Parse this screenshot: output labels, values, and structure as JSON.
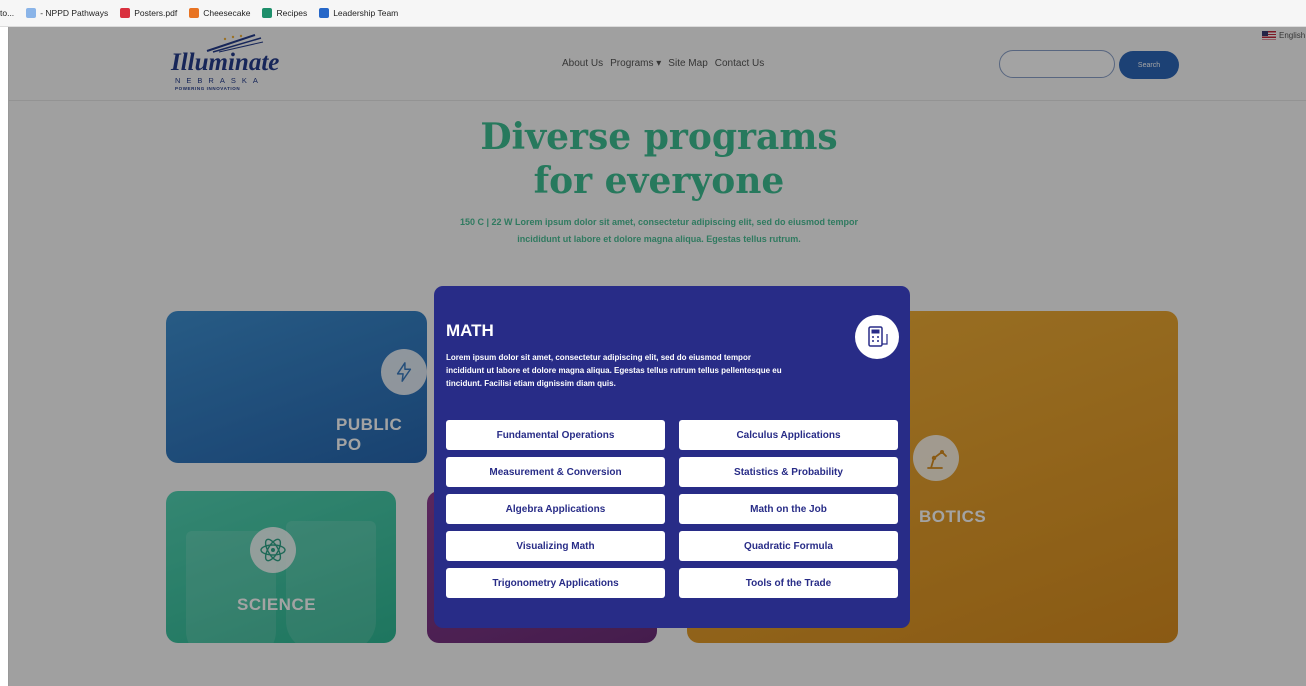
{
  "bookmarks": [
    {
      "label": "to...",
      "color": "#9c9c9c"
    },
    {
      "label": "- NPPD Pathways",
      "color": "#8ab4e8"
    },
    {
      "label": "Posters.pdf",
      "color": "#d9303e"
    },
    {
      "label": "Cheesecake",
      "color": "#e87322"
    },
    {
      "label": "Recipes",
      "color": "#1e8f6b"
    },
    {
      "label": "Leadership Team",
      "color": "#2667c8"
    }
  ],
  "header": {
    "logo": {
      "word": "Illuminate",
      "state": "NEBRASKA",
      "tagline": "POWERING INNOVATION"
    },
    "nav": [
      "About Us",
      "Programs ▾",
      "Site Map",
      "Contact Us"
    ],
    "search": {
      "placeholder": "",
      "button_label": "Search"
    },
    "language": "English"
  },
  "hero": {
    "title_line1": "Diverse programs",
    "title_line2": "for everyone",
    "subtitle": "150 C | 22 W Lorem ipsum dolor sit amet, consectetur adipiscing elit, sed do eiusmod tempor incididunt ut labore et dolore magna aliqua. Egestas tellus rutrum."
  },
  "cards": {
    "public": "PUBLIC PO",
    "science": "SCIENCE",
    "robotics": "BOTICS"
  },
  "modal": {
    "title": "MATH",
    "description": "Lorem ipsum dolor sit amet, consectetur adipiscing elit, sed do eiusmod tempor incididunt ut labore et dolore magna aliqua. Egestas tellus rutrum tellus pellentesque eu tincidunt. Facilisi etiam dignissim diam quis.",
    "topics": [
      "Fundamental Operations",
      "Calculus Applications",
      "Measurement & Conversion",
      "Statistics & Probability",
      "Algebra Applications",
      "Math on the Job",
      "Visualizing Math",
      "Quadratic Formula",
      "Trigonometry Applications",
      "Tools of the Trade"
    ]
  },
  "colors": {
    "accent_green": "#3dbd92",
    "modal_bg": "#282c87",
    "brand_blue": "#243c8c"
  }
}
